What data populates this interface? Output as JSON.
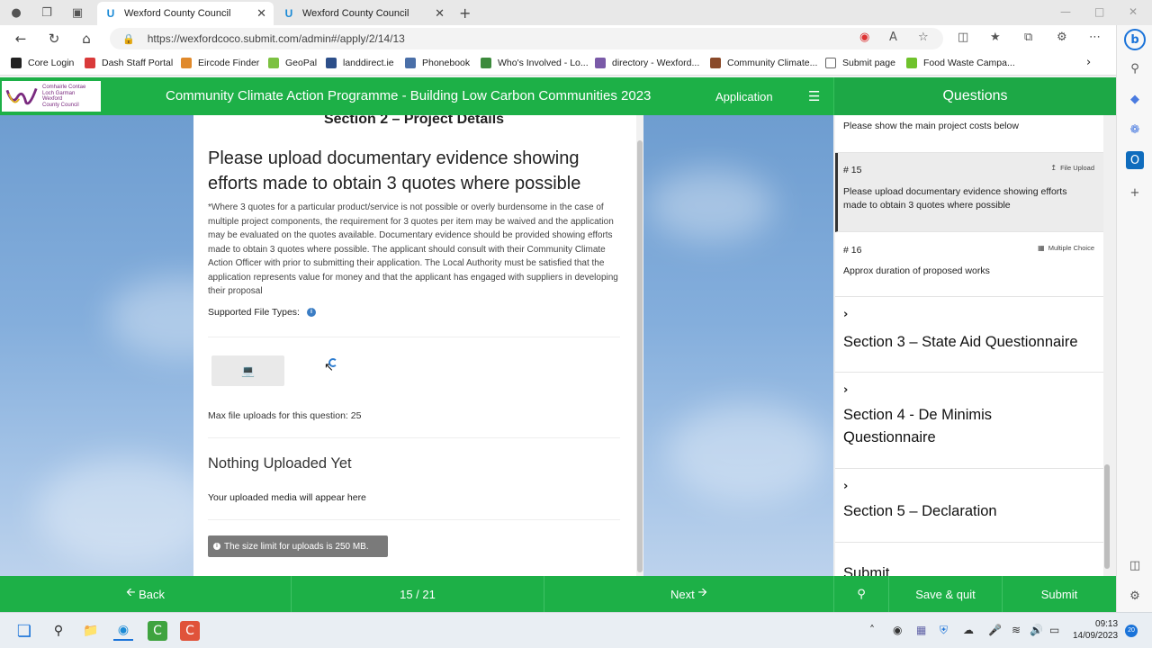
{
  "browser": {
    "tabs": [
      {
        "title": "Wexford County Council",
        "active": true
      },
      {
        "title": "Wexford County Council",
        "active": false
      }
    ],
    "url": "https://wexfordcoco.submit.com/admin#/apply/2/14/13",
    "bookmarks": [
      {
        "label": "Core Login",
        "color": "#222222"
      },
      {
        "label": "Dash Staff Portal",
        "color": "#d93a3a"
      },
      {
        "label": "Eircode Finder",
        "color": "#e0892b"
      },
      {
        "label": "GeoPal",
        "color": "#7cc142"
      },
      {
        "label": "landdirect.ie",
        "color": "#2d4f8a"
      },
      {
        "label": "Phonebook",
        "color": "#4a6fa8"
      },
      {
        "label": "Who's Involved - Lo...",
        "color": "#3c8a3c"
      },
      {
        "label": "directory - Wexford...",
        "color": "#7a5aa8"
      },
      {
        "label": "Community Climate...",
        "color": "#8a4a2a"
      },
      {
        "label": "Submit page",
        "color": "#666666"
      },
      {
        "label": "Food Waste Campa...",
        "color": "#6fc22c"
      }
    ]
  },
  "app": {
    "logo_lines": [
      "Comhairle Contae",
      "Loch Garman",
      "Wexford",
      "County Council"
    ],
    "title": "Community Climate Action Programme - Building Low Carbon Communities 2023",
    "mode": "Application",
    "questions_header": "Questions",
    "brand_color": "#1db047"
  },
  "main": {
    "section_title": "Section 2 – Project Details",
    "question_title": "Please upload documentary evidence showing efforts made to obtain 3 quotes where possible",
    "description": "*Where 3 quotes for a particular product/service is not possible or overly burdensome in the case of multiple project components, the requirement for 3 quotes per item may be waived and the application may be evaluated on the quotes available. Documentary evidence should be provided showing efforts made to obtain 3 quotes where possible. The applicant should consult with their Community Climate Action Officer with prior to submitting their application. The Local Authority must be satisfied that the application represents value for money and that the applicant has engaged with suppliers in developing their proposal",
    "supported_file_types": "Supported File Types:",
    "upload_icon": "laptop-icon",
    "max_uploads": "Max file uploads for this question: 25",
    "nothing_uploaded": "Nothing Uploaded Yet",
    "uploaded_media_note": "Your uploaded media will appear here",
    "size_limit": "The size limit for uploads is 250 MB."
  },
  "questions_panel": {
    "items": [
      {
        "number": "",
        "text": "Please show the main project costs below",
        "type": ""
      },
      {
        "number": "# 15",
        "text": "Please upload documentary evidence showing efforts made to obtain 3 quotes where possible",
        "type": "File Upload",
        "active": true
      },
      {
        "number": "# 16",
        "text": "Approx duration of proposed works",
        "type": "Multiple Choice"
      }
    ],
    "sections": [
      {
        "title": "Section 3 – State Aid Questionnaire"
      },
      {
        "title": "Section 4 - De Minimis Questionnaire"
      },
      {
        "title": "Section 5 – Declaration"
      }
    ],
    "submit_partial": "Submit"
  },
  "bottom_nav": {
    "back": "Back",
    "page": "15 / 21",
    "next": "Next",
    "save_quit": "Save & quit",
    "submit": "Submit"
  },
  "taskbar": {
    "time": "09:13",
    "date": "14/09/2023",
    "notifications": "20"
  }
}
